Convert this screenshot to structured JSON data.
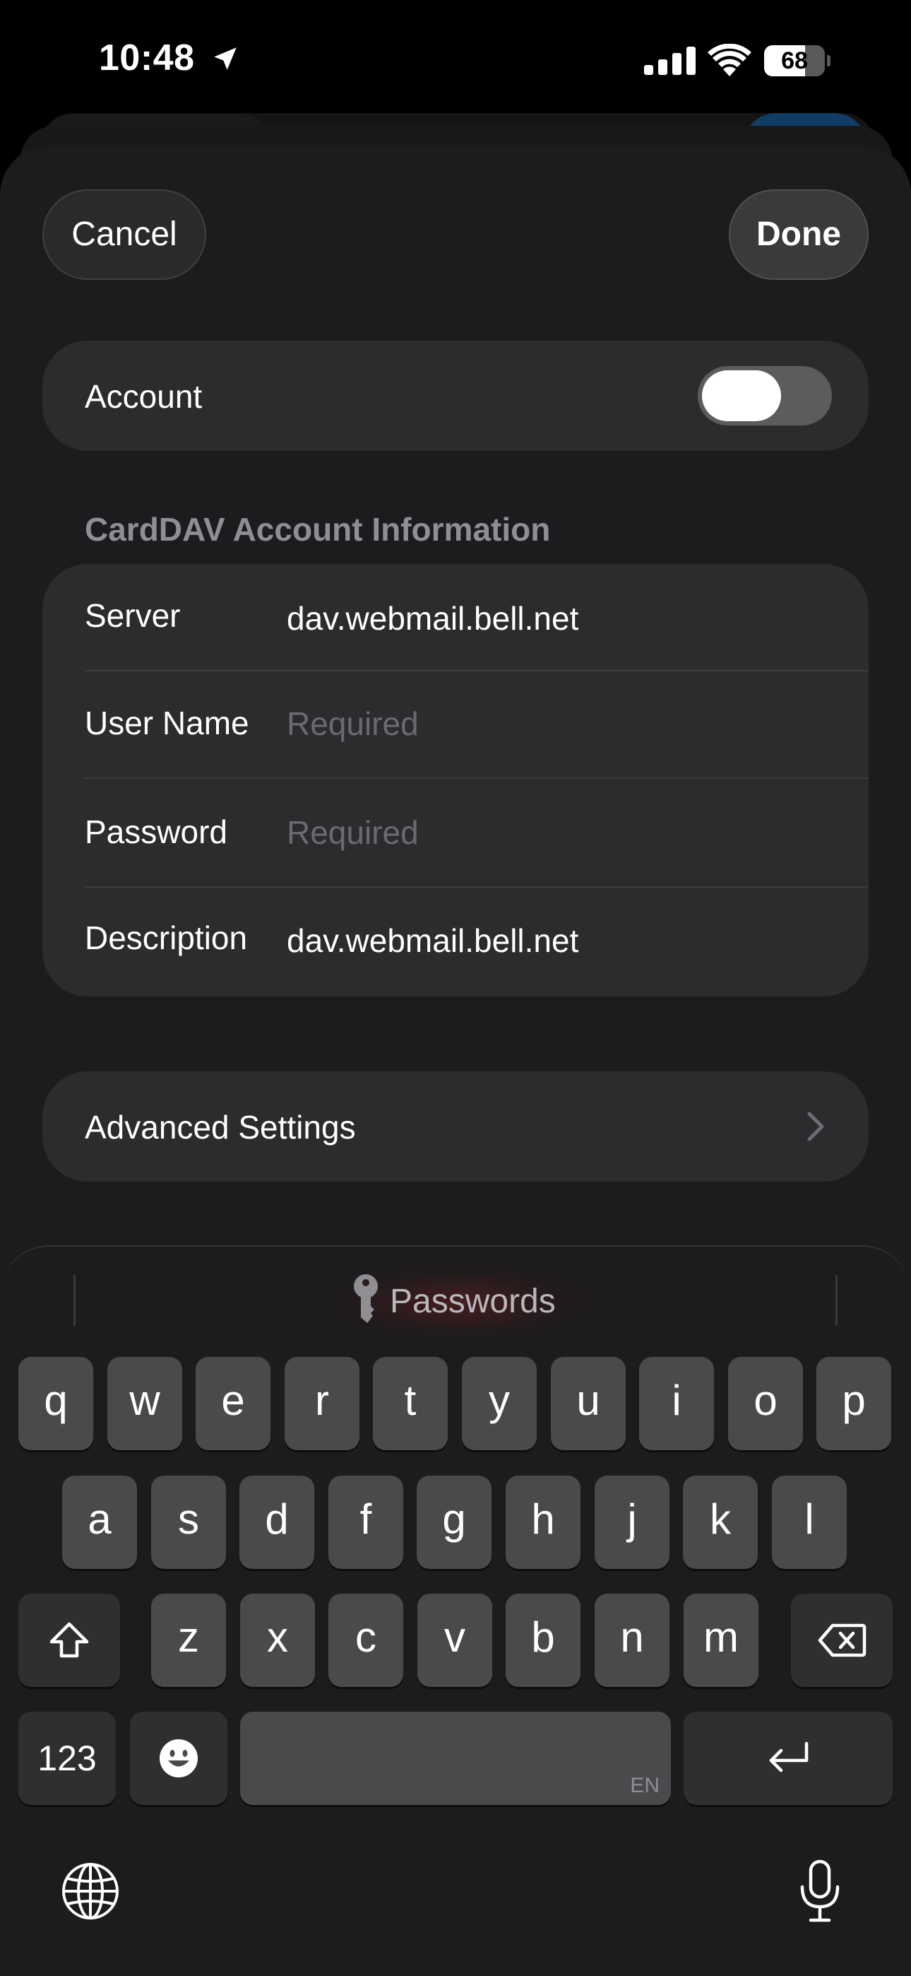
{
  "status_bar": {
    "time": "10:48",
    "battery_percent": "68",
    "battery_level": 0.68
  },
  "header": {
    "cancel_label": "Cancel",
    "done_label": "Done"
  },
  "account": {
    "label": "Account",
    "toggle_on": false
  },
  "section": {
    "header": "CardDAV Account Information"
  },
  "fields": {
    "server": {
      "label": "Server",
      "value": "dav.webmail.bell.net"
    },
    "user_name": {
      "label": "User Name",
      "placeholder": "Required"
    },
    "password": {
      "label": "Password",
      "placeholder": "Required"
    },
    "description": {
      "label": "Description",
      "value": "dav.webmail.bell.net"
    }
  },
  "advanced": {
    "label": "Advanced Settings"
  },
  "keyboard": {
    "passwords_label": "Passwords",
    "row1": [
      "q",
      "w",
      "e",
      "r",
      "t",
      "y",
      "u",
      "i",
      "o",
      "p"
    ],
    "row2": [
      "a",
      "s",
      "d",
      "f",
      "g",
      "h",
      "j",
      "k",
      "l"
    ],
    "row3": [
      "z",
      "x",
      "c",
      "v",
      "b",
      "n",
      "m"
    ],
    "numbers_label": "123",
    "space_language": "EN"
  },
  "colors": {
    "sheet_bg": "#1c1c1e",
    "group_bg": "#2c2c2e",
    "key_bg": "#4a4a4c",
    "section_header": "#8e8e93",
    "placeholder": "#6b6b6f"
  }
}
